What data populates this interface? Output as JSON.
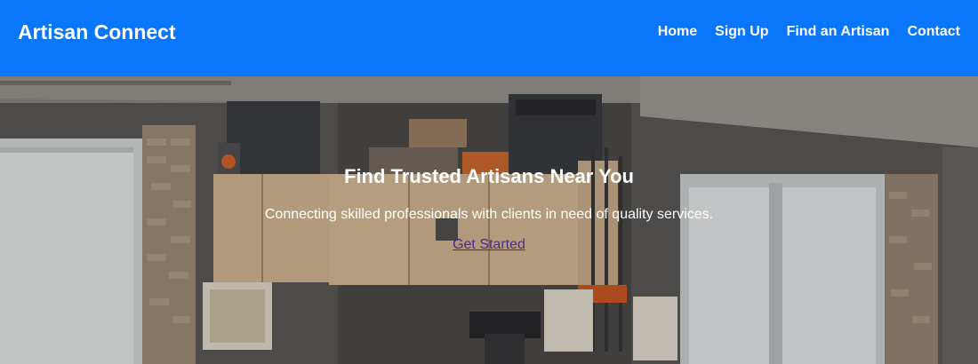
{
  "header": {
    "brand": "Artisan Connect",
    "nav": [
      {
        "label": "Home"
      },
      {
        "label": "Sign Up"
      },
      {
        "label": "Find an Artisan"
      },
      {
        "label": "Contact"
      }
    ]
  },
  "hero": {
    "title": "Find Trusted Artisans Near You",
    "subtitle": "Connecting skilled professionals with clients in need of quality services.",
    "cta_label": "Get Started"
  },
  "colors": {
    "navbar_bg": "#0a76fb",
    "nav_text": "#ffffff",
    "link_visited": "#4b2a91"
  }
}
